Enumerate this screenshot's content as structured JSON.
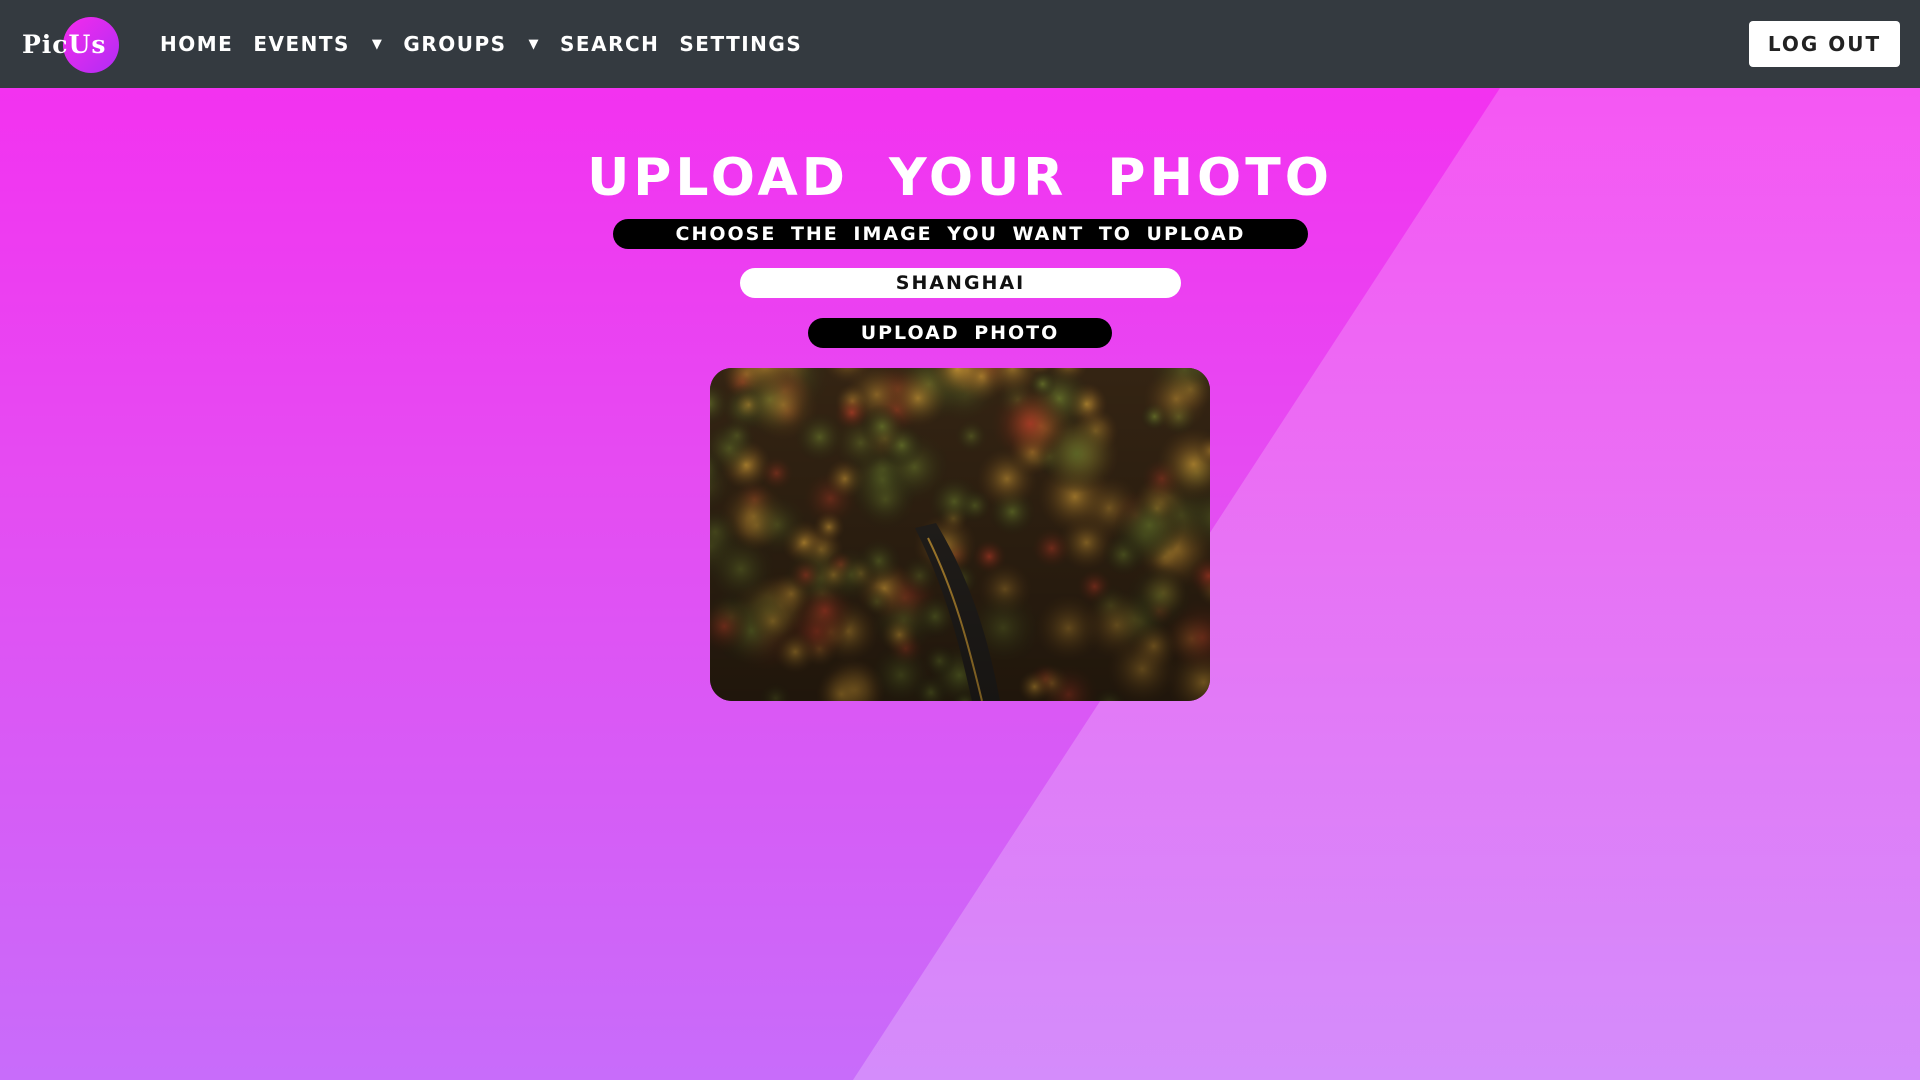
{
  "navbar": {
    "brand": "PicUs",
    "items": [
      {
        "label": "HOME",
        "dropdown": false
      },
      {
        "label": "EVENTS",
        "dropdown": true
      },
      {
        "label": "GROUPS",
        "dropdown": true
      },
      {
        "label": "SEARCH",
        "dropdown": false
      },
      {
        "label": "SETTINGS",
        "dropdown": false
      }
    ],
    "logout_label": "LOG OUT"
  },
  "main": {
    "title": "UPLOAD YOUR PHOTO",
    "subtitle": "CHOOSE THE IMAGE YOU WANT TO UPLOAD",
    "location_input_value": "SHANGHAI",
    "upload_button_label": "UPLOAD PHOTO",
    "preview_image": "aerial-autumn-forest-road"
  },
  "colors": {
    "navbar_bg": "#343a40",
    "background_top": "#f62cf0",
    "background_bottom": "#c86cfa",
    "pill_bg": "#000000"
  }
}
